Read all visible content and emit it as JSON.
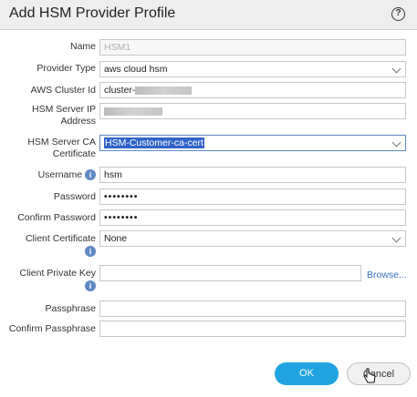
{
  "dialog": {
    "title": "Add HSM Provider Profile",
    "help_icon": "?"
  },
  "form": {
    "name": {
      "label": "Name",
      "placeholder": "HSM1"
    },
    "provider_type": {
      "label": "Provider Type",
      "value": "aws cloud hsm"
    },
    "aws_cluster_id": {
      "label": "AWS Cluster Id",
      "value": "cluster-"
    },
    "hsm_server_ip": {
      "label": "HSM Server IP Address"
    },
    "hsm_server_ca": {
      "label": "HSM Server CA Certificate",
      "value": "HSM-Customer-ca-cert"
    },
    "username": {
      "label": "Username",
      "value": "hsm"
    },
    "password": {
      "label": "Password",
      "value": "••••••••"
    },
    "confirm_password": {
      "label": "Confirm Password",
      "value": "••••••••"
    },
    "client_certificate": {
      "label": "Client Certificate",
      "value": "None"
    },
    "client_private_key": {
      "label": "Client Private Key",
      "browse_label": "Browse..."
    },
    "passphrase": {
      "label": "Passphrase"
    },
    "confirm_passphrase": {
      "label": "Confirm Passphrase"
    }
  },
  "buttons": {
    "ok": "OK",
    "cancel": "Cancel"
  },
  "colors": {
    "accent": "#1fa4e0",
    "info": "#5e88c4",
    "selection": "#3063c8",
    "link": "#3a73c2"
  }
}
